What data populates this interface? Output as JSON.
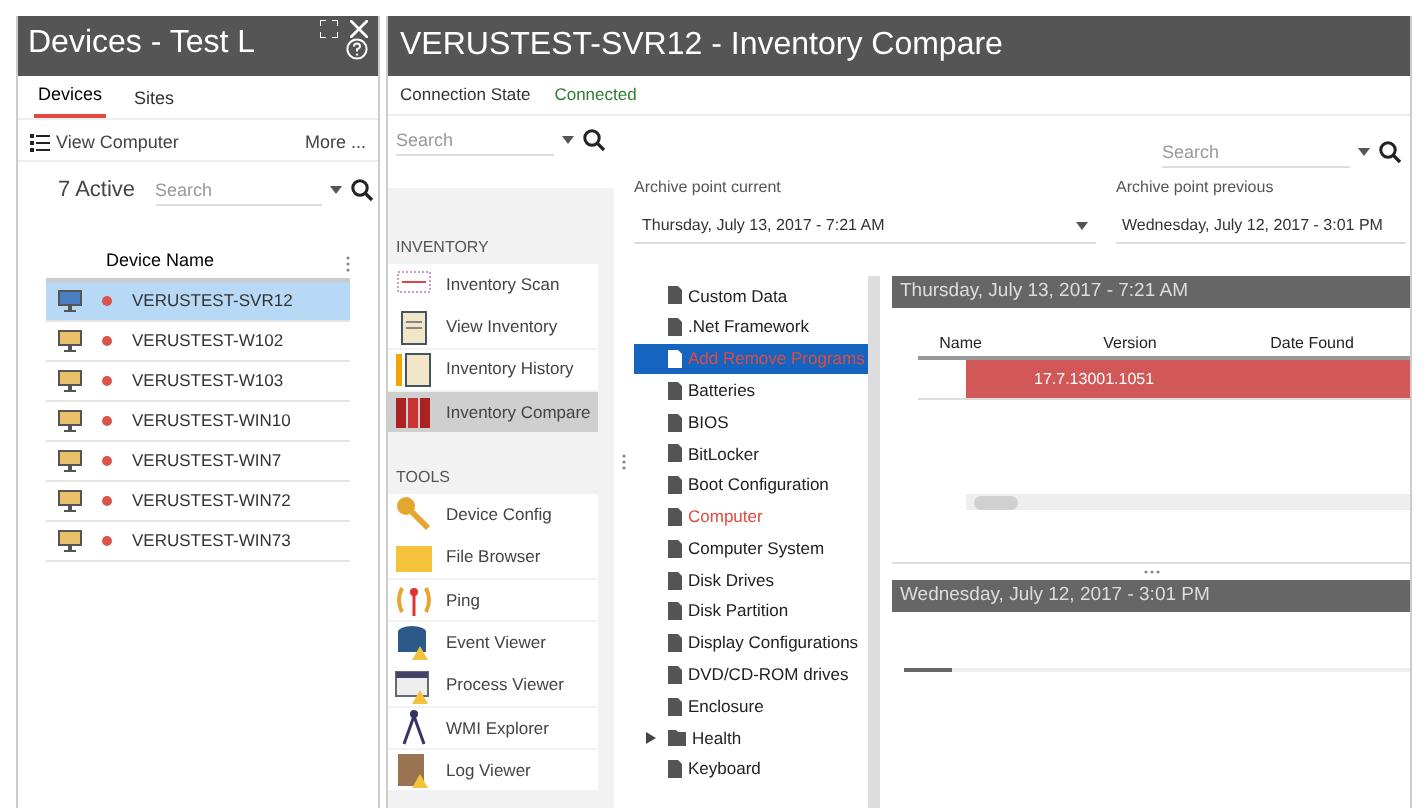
{
  "devices_panel": {
    "title": "Devices - Test L",
    "tabs": [
      {
        "label": "Devices",
        "selected": true
      },
      {
        "label": "Sites",
        "selected": false
      }
    ],
    "toolbar": {
      "view_computer": "View Computer",
      "more": "More ..."
    },
    "active_count": "7 Active",
    "search": {
      "placeholder": "Search"
    },
    "table": {
      "columns": [
        "Device Name"
      ],
      "rows": [
        {
          "name": "VERUSTEST-SVR12",
          "selected": true,
          "color": "#d9534f"
        },
        {
          "name": "VERUSTEST-W102",
          "selected": false,
          "color": "#d9534f"
        },
        {
          "name": "VERUSTEST-W103",
          "selected": false,
          "color": "#d9534f"
        },
        {
          "name": "VERUSTEST-WIN10",
          "selected": false,
          "color": "#d9534f"
        },
        {
          "name": "VERUSTEST-WIN7",
          "selected": false,
          "color": "#d9534f"
        },
        {
          "name": "VERUSTEST-WIN72",
          "selected": false,
          "color": "#d9534f"
        },
        {
          "name": "VERUSTEST-WIN73",
          "selected": false,
          "color": "#d9534f"
        }
      ]
    }
  },
  "window": {
    "title": "VERUSTEST-SVR12 - Inventory Compare",
    "connection_state": {
      "label": "Connection State",
      "value": "Connected"
    },
    "nav": {
      "search": {
        "placeholder": "Search"
      },
      "sections": [
        {
          "heading": "INVENTORY",
          "items": [
            {
              "label": "Inventory Scan",
              "kind": "scan",
              "selected": false
            },
            {
              "label": "View Inventory",
              "kind": "clipboard",
              "selected": false
            },
            {
              "label": "Inventory History",
              "kind": "history",
              "selected": false
            },
            {
              "label": "Inventory Compare",
              "kind": "binders",
              "selected": true
            }
          ]
        },
        {
          "heading": "TOOLS",
          "items": [
            {
              "label": "Device Config",
              "kind": "key",
              "selected": false
            },
            {
              "label": "File Browser",
              "kind": "folder",
              "selected": false
            },
            {
              "label": "Ping",
              "kind": "ping",
              "selected": false
            },
            {
              "label": "Event Viewer",
              "kind": "database",
              "selected": false
            },
            {
              "label": "Process Viewer",
              "kind": "process",
              "selected": false
            },
            {
              "label": "WMI Explorer",
              "kind": "compass",
              "selected": false
            },
            {
              "label": "Log Viewer",
              "kind": "book",
              "selected": false
            }
          ]
        }
      ]
    },
    "main": {
      "search": {
        "placeholder": "Search"
      },
      "archive_current": {
        "label": "Archive point current",
        "value": "Thursday, July 13, 2017 - 7:21 AM"
      },
      "archive_previous": {
        "label": "Archive point previous",
        "value": "Wednesday, July 12, 2017 - 3:01 PM"
      },
      "tree": [
        {
          "label": "Custom Data",
          "kind": "file",
          "selected": false,
          "changed": false
        },
        {
          "label": ".Net Framework",
          "kind": "file",
          "selected": false,
          "changed": false
        },
        {
          "label": "Add Remove Programs",
          "kind": "file",
          "selected": true,
          "changed": true
        },
        {
          "label": "Batteries",
          "kind": "file",
          "selected": false,
          "changed": false
        },
        {
          "label": "BIOS",
          "kind": "file",
          "selected": false,
          "changed": false
        },
        {
          "label": "BitLocker",
          "kind": "file",
          "selected": false,
          "changed": false
        },
        {
          "label": "Boot Configuration",
          "kind": "file",
          "selected": false,
          "changed": false
        },
        {
          "label": "Computer",
          "kind": "file",
          "selected": false,
          "changed": true
        },
        {
          "label": "Computer System",
          "kind": "file",
          "selected": false,
          "changed": false
        },
        {
          "label": "Disk Drives",
          "kind": "file",
          "selected": false,
          "changed": false
        },
        {
          "label": "Disk Partition",
          "kind": "file",
          "selected": false,
          "changed": false
        },
        {
          "label": "Display Configurations",
          "kind": "file",
          "selected": false,
          "changed": false
        },
        {
          "label": "DVD/CD-ROM drives",
          "kind": "file",
          "selected": false,
          "changed": false
        },
        {
          "label": "Enclosure",
          "kind": "file",
          "selected": false,
          "changed": false
        },
        {
          "label": "Health",
          "kind": "folder",
          "selected": false,
          "changed": false
        },
        {
          "label": "Keyboard",
          "kind": "file",
          "selected": false,
          "changed": false
        }
      ],
      "current_panel": {
        "title": "Thursday, July 13, 2017 - 7:21 AM",
        "columns": [
          "Name",
          "Version",
          "Date Found"
        ],
        "rows": [
          {
            "cells": [
              "",
              "17.7.13001.1051",
              ""
            ],
            "changed": true
          }
        ]
      },
      "previous_panel": {
        "title": "Wednesday, July 12, 2017 - 3:01 PM"
      }
    }
  }
}
